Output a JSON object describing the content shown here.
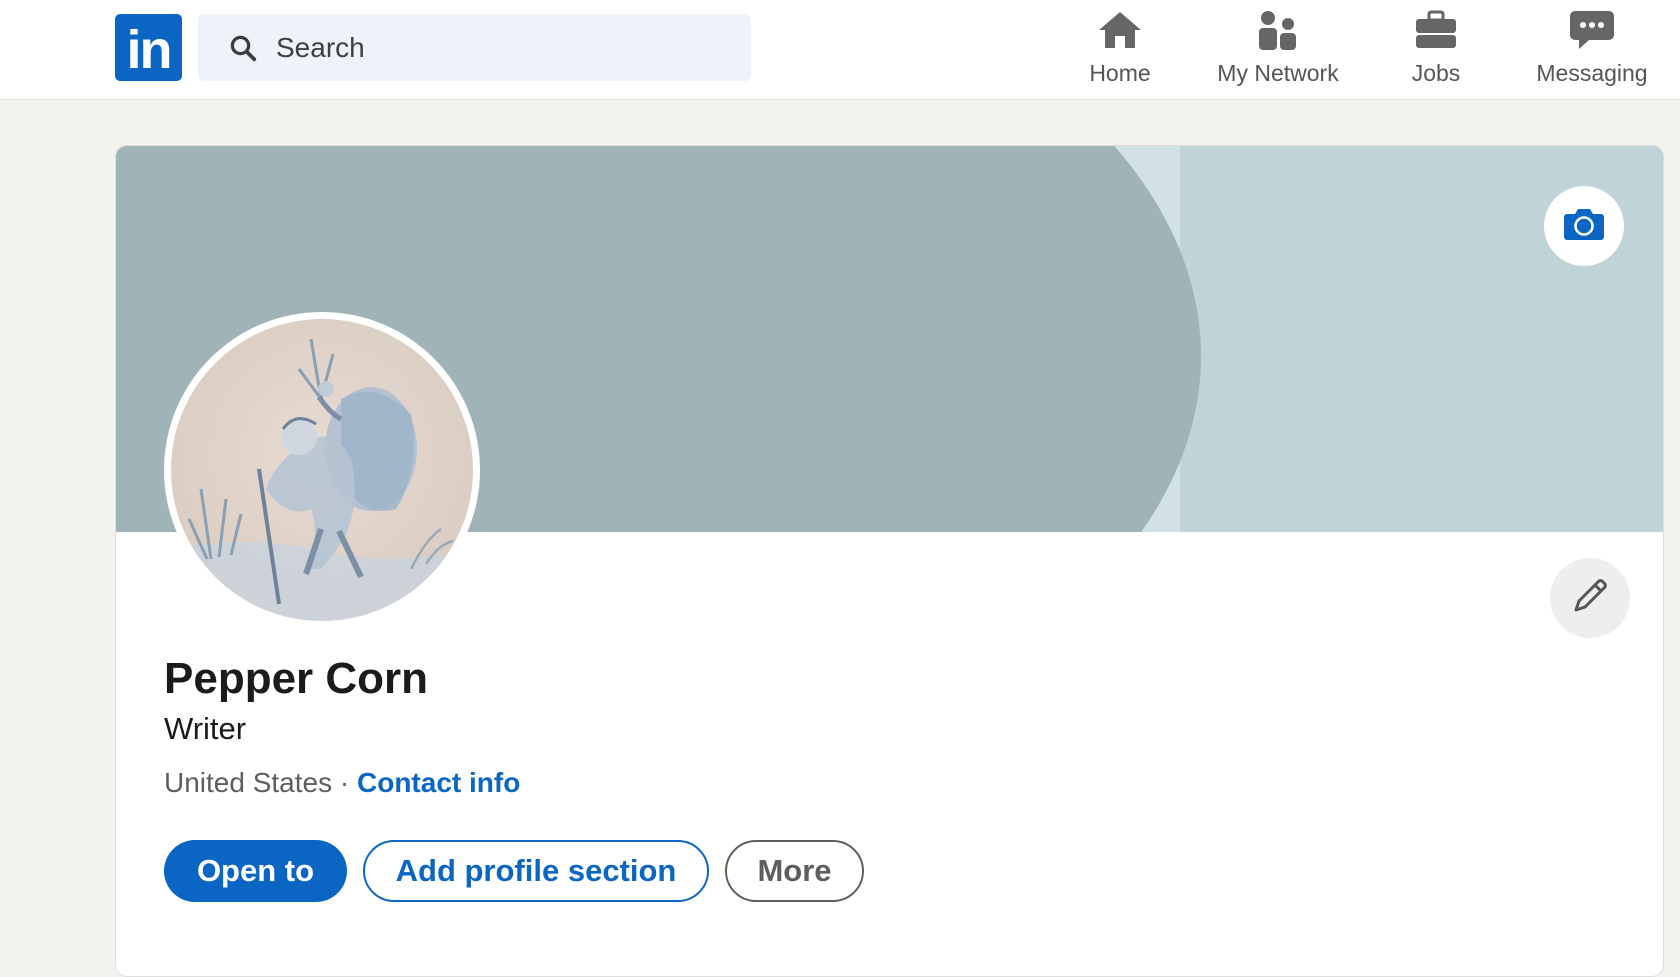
{
  "brand": {
    "logo_text": "in",
    "accent_color": "#0a66c2"
  },
  "search": {
    "placeholder": "Search",
    "value": ""
  },
  "nav": {
    "items": [
      {
        "label": "Home",
        "icon": "home-icon"
      },
      {
        "label": "My Network",
        "icon": "my-network-icon"
      },
      {
        "label": "Jobs",
        "icon": "jobs-icon"
      },
      {
        "label": "Messaging",
        "icon": "messaging-icon"
      }
    ]
  },
  "profile": {
    "name": "Pepper Corn",
    "headline": "Writer",
    "location": "United States",
    "separator": "·",
    "contact_label": "Contact info"
  },
  "actions": {
    "open_to_label": "Open to",
    "add_section_label": "Add profile section",
    "more_label": "More"
  },
  "colors": {
    "banner": "#a0b4b7",
    "banner_accent": "#c0d4d8",
    "page_background": "#f3f2ef"
  }
}
